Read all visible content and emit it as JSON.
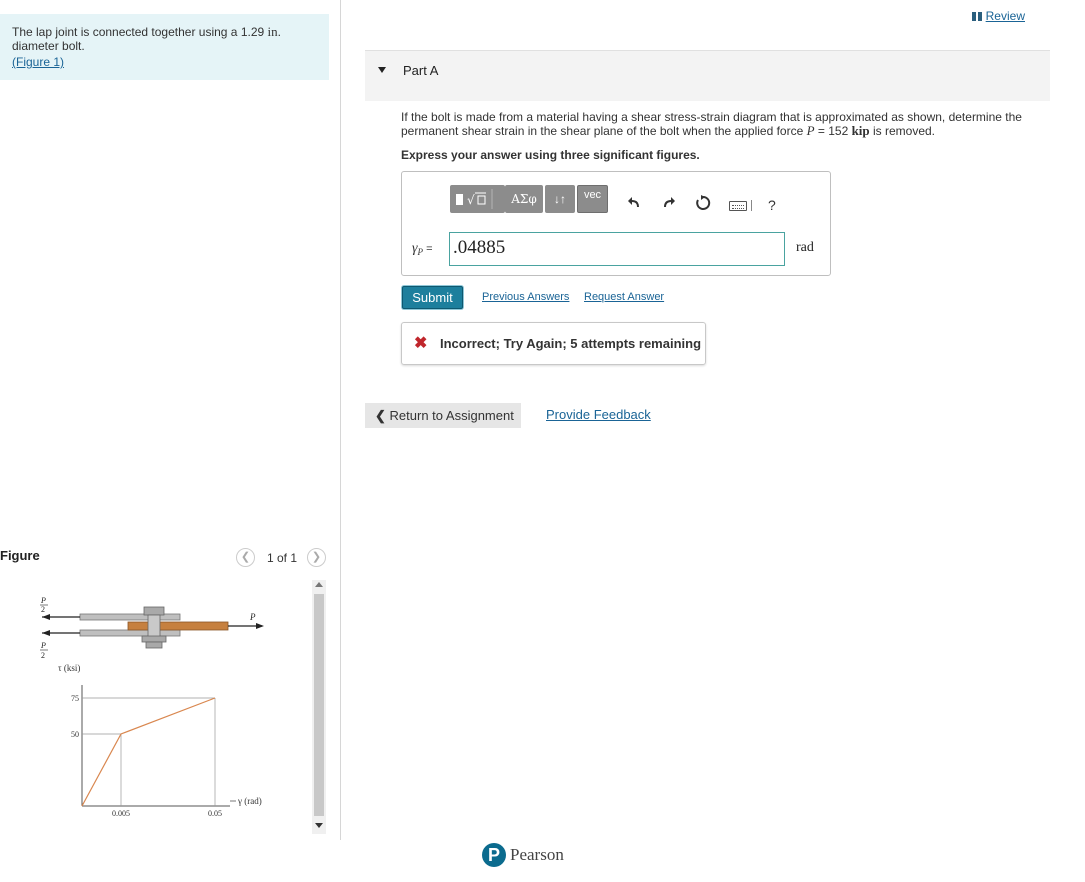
{
  "problem": {
    "text_before": "The lap joint is connected together using a 1.29 ",
    "unit_in": "in",
    "text_after": ". diameter bolt.",
    "figure_link": "(Figure 1)"
  },
  "review": {
    "label": "Review"
  },
  "part": {
    "title": "Part A"
  },
  "question": {
    "text_1": "If the bolt is made from a material having a shear stress-strain diagram that is approximated as shown, determine the permanent shear strain in the shear plane of the bolt when the applied force ",
    "force_var": "P",
    "text_2": " = 152 ",
    "force_unit": "kip",
    "text_3": " is removed.",
    "instruction": "Express your answer using three significant figures."
  },
  "toolbar": {
    "greek_label": "ΑΣφ",
    "arrows_label": "↓↑",
    "vec_label": "vec",
    "undo_icon": "undo-icon",
    "redo_icon": "redo-icon",
    "reset_icon": "reset-icon",
    "keyboard_icon": "keyboard-icon",
    "help_label": "?"
  },
  "answer": {
    "variable_symbol": "γ",
    "variable_sub": "P",
    "equals": "=",
    "value": ".04885",
    "unit": "rad"
  },
  "actions": {
    "submit": "Submit",
    "previous_answers": "Previous Answers",
    "request_answer": "Request Answer"
  },
  "feedback": {
    "icon": "✖",
    "message": "Incorrect; Try Again; 5 attempts remaining"
  },
  "navigation": {
    "return_label": "Return to Assignment",
    "provide_feedback": "Provide Feedback"
  },
  "figure": {
    "heading": "Figure",
    "pager": "1 of 1",
    "load_label": "P",
    "half_label_num": "P",
    "half_label_den": "2",
    "tau_axis": "τ (ksi)",
    "gamma_axis": "γ (rad)",
    "y_ticks": [
      "75",
      "50"
    ],
    "x_ticks": [
      "0.005",
      "0.05"
    ]
  },
  "chart_data": {
    "type": "line",
    "ylabel": "τ (ksi)",
    "xlabel": "γ (rad)",
    "series": [
      {
        "x": [
          0,
          0.005,
          0.05
        ],
        "y": [
          0,
          50,
          75
        ]
      }
    ],
    "x_ticks": [
      0.005,
      0.05
    ],
    "y_ticks": [
      50,
      75
    ]
  },
  "footer": {
    "brand": "Pearson"
  },
  "colors": {
    "link": "#1a6496",
    "submit": "#1d7f9d",
    "error": "#c0262c",
    "curve": "#d9874f",
    "bar": "#c6803f"
  }
}
